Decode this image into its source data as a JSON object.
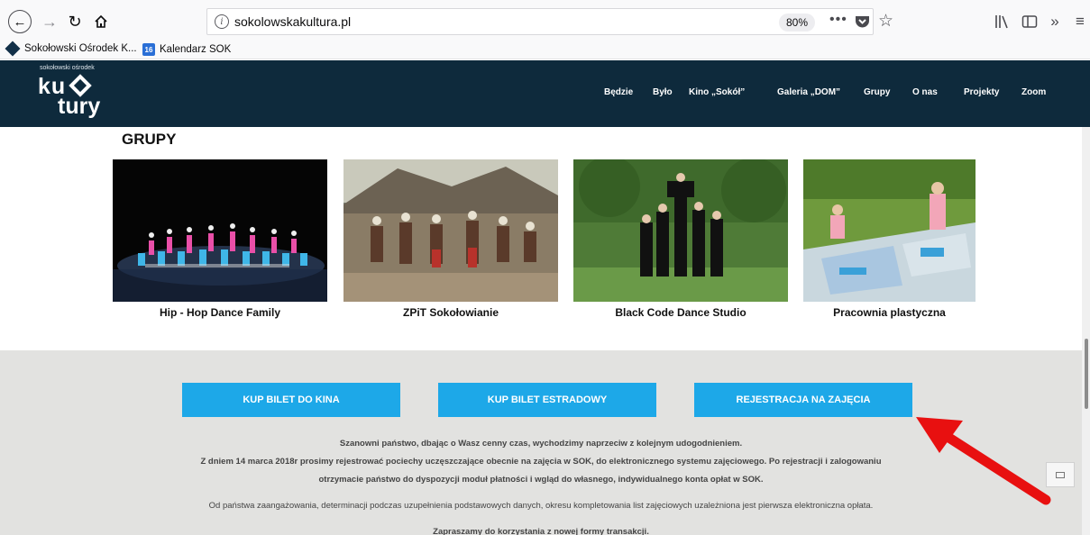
{
  "browser": {
    "url": "sokolowskakultura.pl",
    "zoom": "80%",
    "more_label": "•••",
    "bookmarks": [
      {
        "label": "Sokołowski Ośrodek K...",
        "icon": "sok-logo-icon"
      },
      {
        "label": "Kalendarz SOK",
        "icon": "calendar-icon",
        "icon_text": "16"
      }
    ]
  },
  "site": {
    "logo": {
      "small": "sokołowski ośrodek",
      "line1": "ku",
      "line2": "tury"
    },
    "nav": [
      "Będzie",
      "Było",
      "Kino „Sokół”",
      "Galeria „DOM”",
      "Grupy",
      "O nas",
      "Projekty",
      "Zoom"
    ],
    "section_title": "GRUPY",
    "groups": [
      {
        "caption": "Hip - Hop Dance Family"
      },
      {
        "caption": "ZPiT Sokołowianie"
      },
      {
        "caption": "Black Code Dance Studio"
      },
      {
        "caption": "Pracownia plastyczna"
      }
    ],
    "buttons": [
      "KUP BILET DO KINA",
      "KUP BILET ESTRADOWY",
      "REJESTRACJA NA ZAJĘCIA"
    ],
    "text": {
      "line1": "Szanowni państwo, dbając o Wasz cenny czas, wychodzimy naprzeciw z kolejnym udogodnieniem.",
      "line2": "Z dniem 14 marca 2018r prosimy rejestrować pociechy uczęszczające obecnie na zajęcia w SOK, do elektronicznego systemu zajęciowego. Po rejestracji i zalogowaniu",
      "line3": "otrzymacie państwo do dyspozycji moduł płatności i wgląd do własnego, indywidualnego konta opłat w SOK.",
      "line4": "Od państwa zaangażowania, determinacji podczas uzupełnienia podstawowych danych, okresu kompletowania list zajęciowych uzależniona jest pierwsza elektroniczna opłata.",
      "line5": "Zapraszamy do korzystania z nowej formy transakcji."
    }
  },
  "colors": {
    "header": "#0e2a3c",
    "cta": "#1da8e8",
    "band": "#e2e2e0",
    "arrow": "#e81010"
  }
}
